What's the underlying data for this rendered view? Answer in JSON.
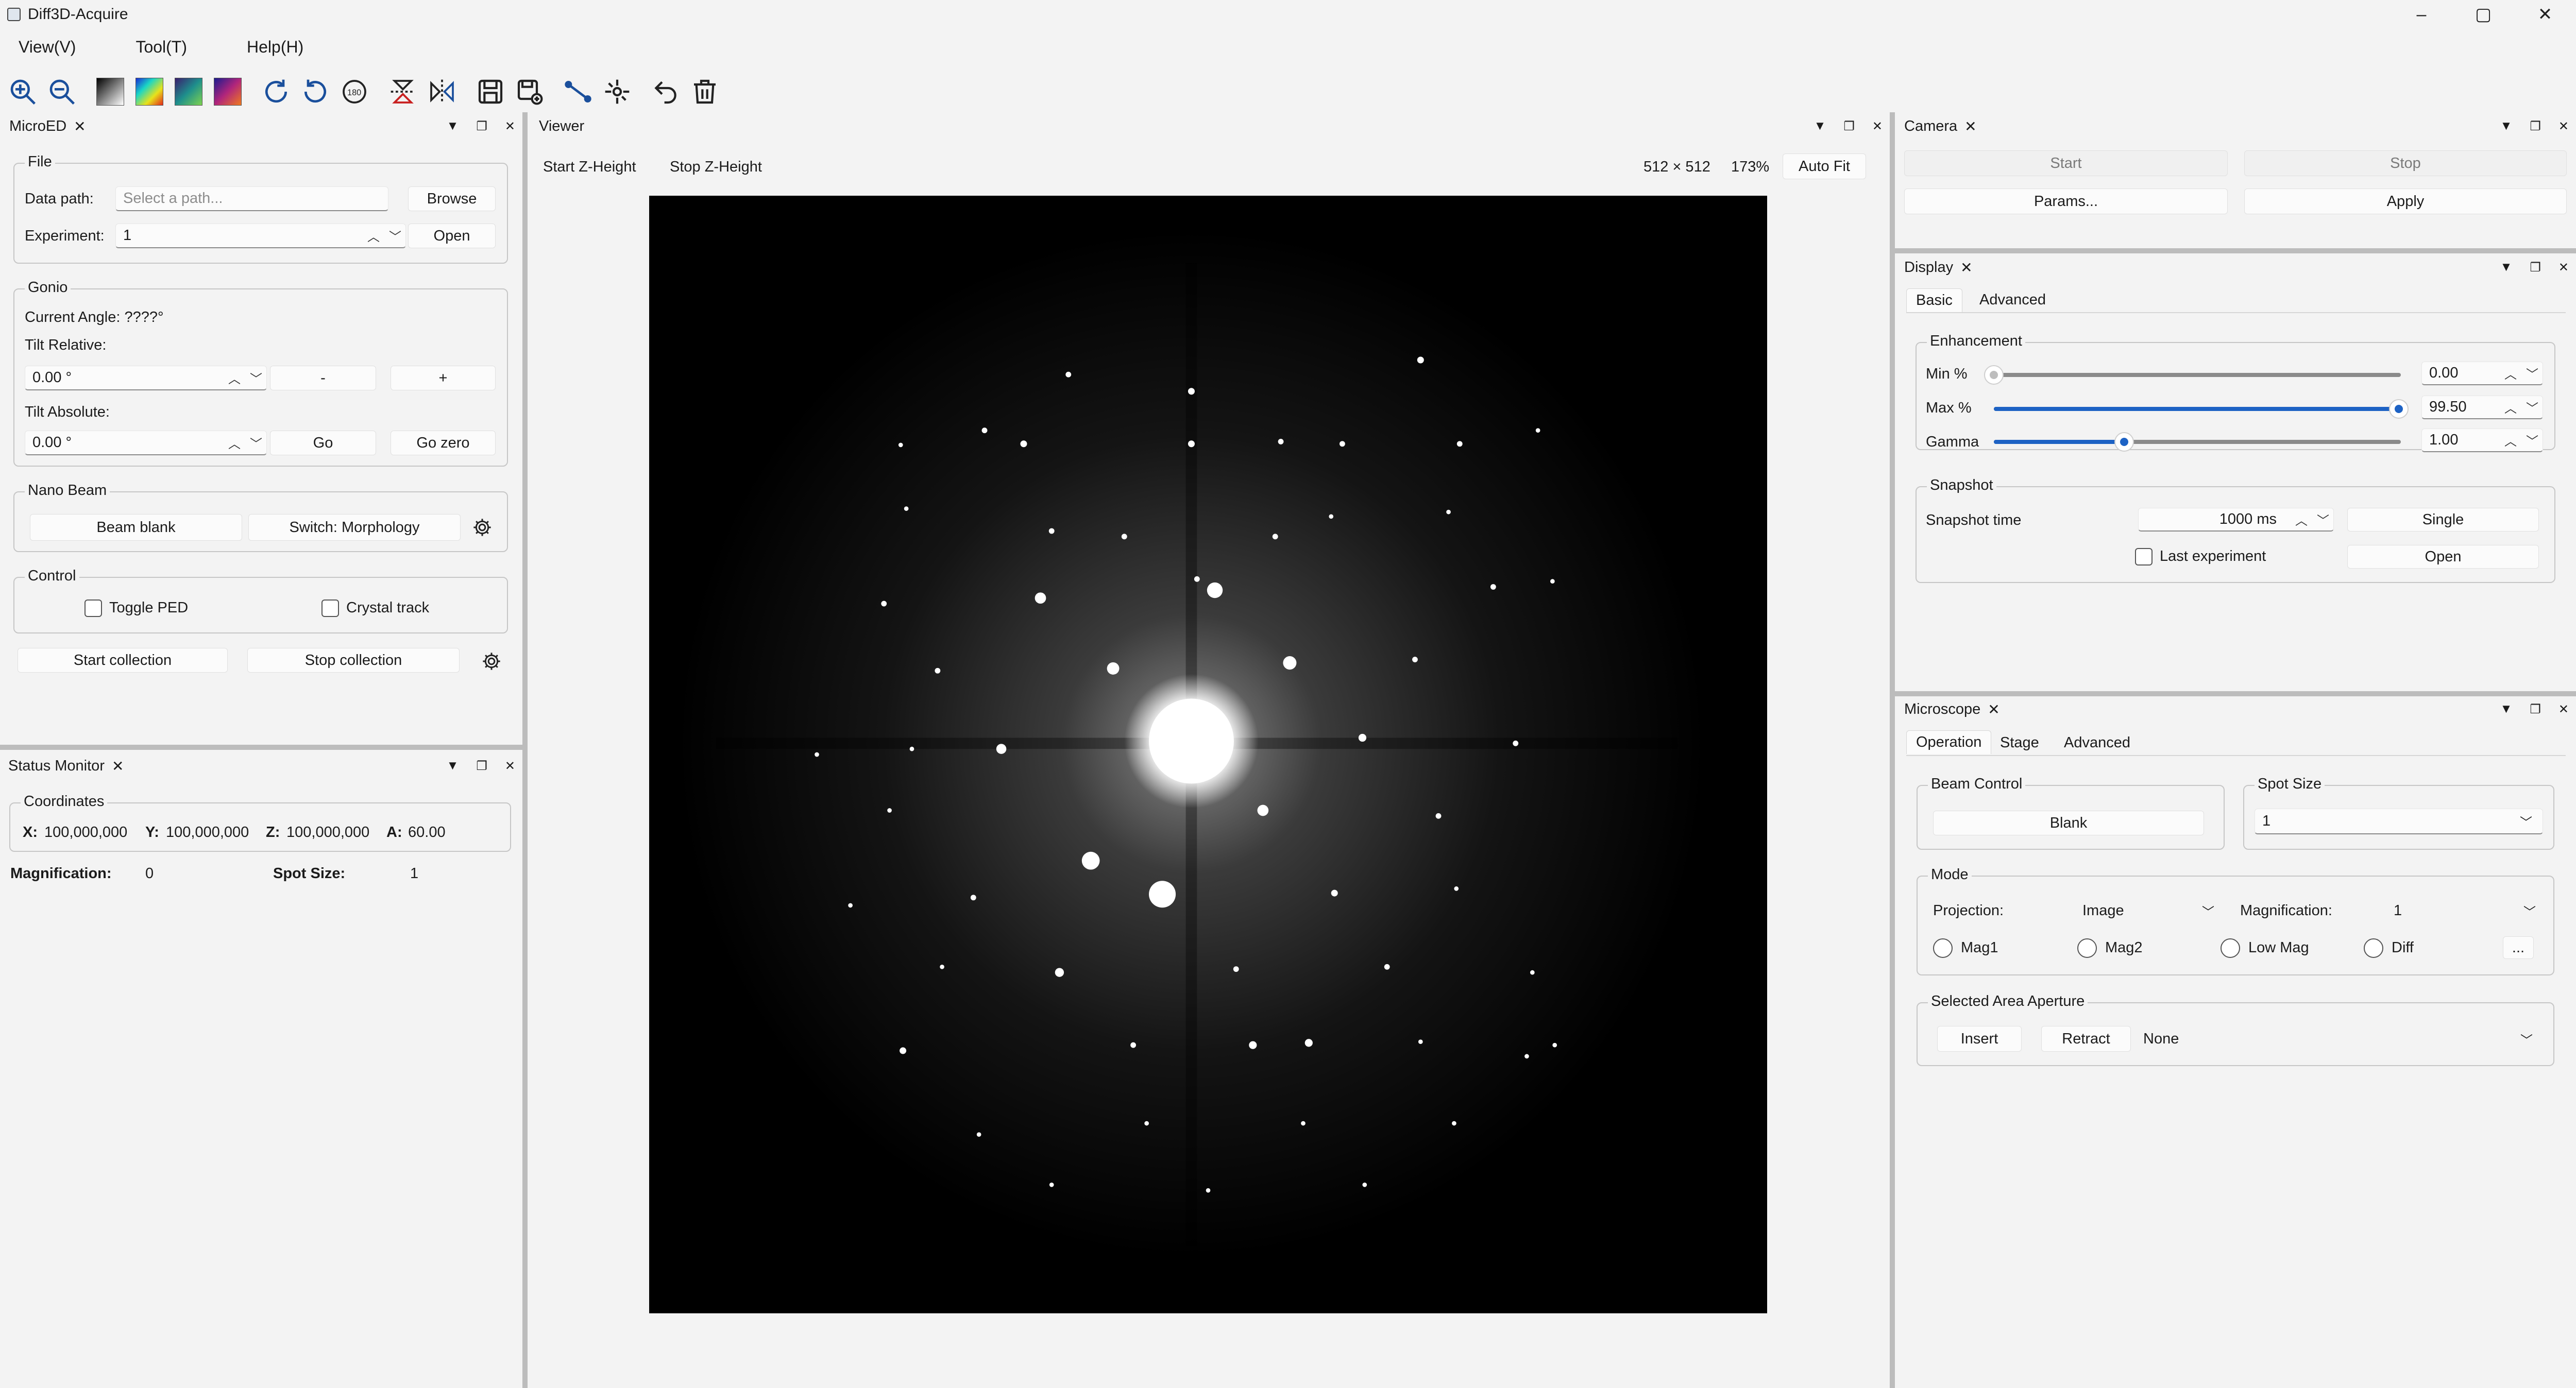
{
  "window": {
    "title": "Diff3D-Acquire",
    "controls": [
      "–",
      "▢",
      "✕"
    ]
  },
  "menu": [
    "View(V)",
    "Tool(T)",
    "Help(H)"
  ],
  "microed": {
    "title": "MicroED",
    "file": {
      "label": "File",
      "data_path_label": "Data path:",
      "data_path_placeholder": "Select a path...",
      "browse": "Browse",
      "experiment_label": "Experiment:",
      "experiment_value": "1",
      "open": "Open"
    },
    "gonio": {
      "label": "Gonio",
      "current_angle": "Current Angle: ????°",
      "tilt_relative_label": "Tilt Relative:",
      "tilt_relative_value": "0.00 °",
      "minus": "-",
      "plus": "+",
      "tilt_absolute_label": "Tilt Absolute:",
      "tilt_absolute_value": "0.00 °",
      "go": "Go",
      "go_zero": "Go zero"
    },
    "nano_beam": {
      "label": "Nano Beam",
      "beam_blank": "Beam blank",
      "switch": "Switch: Morphology"
    },
    "control": {
      "label": "Control",
      "toggle_ped": "Toggle PED",
      "crystal_track": "Crystal track"
    },
    "start_collection": "Start collection",
    "stop_collection": "Stop collection"
  },
  "status": {
    "title": "Status Monitor",
    "coordinates_label": "Coordinates",
    "x_label": "X:",
    "x_value": "100,000,000",
    "y_label": "Y:",
    "y_value": "100,000,000",
    "z_label": "Z:",
    "z_value": "100,000,000",
    "a_label": "A:",
    "a_value": "60.00",
    "magnification_label": "Magnification:",
    "magnification_value": "0",
    "spot_size_label": "Spot Size:",
    "spot_size_value": "1"
  },
  "viewer": {
    "title": "Viewer",
    "start_z": "Start Z-Height",
    "stop_z": "Stop Z-Height",
    "dims": "512 × 512",
    "zoom": "173%",
    "auto_fit": "Auto Fit"
  },
  "camera": {
    "title": "Camera",
    "start": "Start",
    "stop": "Stop",
    "params": "Params...",
    "apply": "Apply"
  },
  "display": {
    "title": "Display",
    "tabs": [
      "Basic",
      "Advanced"
    ],
    "enhancement_label": "Enhancement",
    "min_label": "Min %",
    "min_value": "0.00",
    "min_fraction": 0.0,
    "max_label": "Max %",
    "max_value": "99.50",
    "max_fraction": 0.995,
    "gamma_label": "Gamma",
    "gamma_value": "1.00",
    "gamma_fraction": 0.32,
    "snapshot_label": "Snapshot",
    "snapshot_time_label": "Snapshot time",
    "snapshot_time_value": "1000 ms",
    "single": "Single",
    "last_experiment": "Last experiment",
    "open": "Open"
  },
  "microscope": {
    "title": "Microscope",
    "tabs": [
      "Operation",
      "Stage",
      "Advanced"
    ],
    "beam_control_label": "Beam Control",
    "blank": "Blank",
    "spot_size_label": "Spot Size",
    "spot_size_value": "1",
    "mode_label": "Mode",
    "projection_label": "Projection:",
    "projection_value": "Image",
    "magnification_label": "Magnification:",
    "magnification_value": "1",
    "radios": [
      "Mag1",
      "Mag2",
      "Low Mag",
      "Diff"
    ],
    "more": "...",
    "saa_label": "Selected Area Aperture",
    "insert": "Insert",
    "retract": "Retract",
    "aperture_value": "None"
  },
  "colors": {
    "accent": "#1d62c4",
    "background": "#f3f3f3"
  }
}
